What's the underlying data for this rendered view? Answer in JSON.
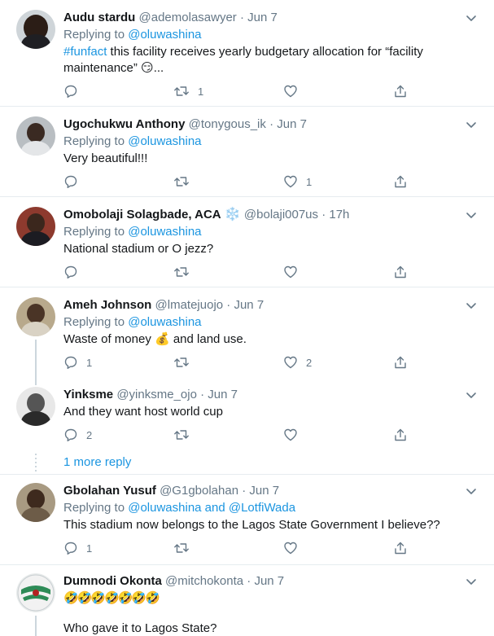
{
  "tweets": [
    {
      "name": "Audu stardu",
      "handle": "@ademolasawyer",
      "time": "Jun 7",
      "replying_prefix": "Replying to",
      "replying_to": "@oluwashina",
      "hashtag": "#funfact",
      "text": " this facility receives yearly budgetary allocation for “facility maintenance” 😏...",
      "reply_count": "",
      "retweet_count": "1",
      "like_count": ""
    },
    {
      "name": "Ugochukwu Anthony",
      "handle": "@tonygous_ik",
      "time": "Jun 7",
      "replying_prefix": "Replying to",
      "replying_to": "@oluwashina",
      "text": "Very beautiful!!!",
      "reply_count": "",
      "retweet_count": "",
      "like_count": "1"
    },
    {
      "name": "Omobolaji Solagbade, ACA",
      "badge": "❄️",
      "handle": "@bolaji007us",
      "time": "17h",
      "replying_prefix": "Replying to",
      "replying_to": "@oluwashina",
      "text": "National stadium or O jezz?",
      "reply_count": "",
      "retweet_count": "",
      "like_count": ""
    },
    {
      "name": "Ameh Johnson",
      "handle": "@lmatejuojo",
      "time": "Jun 7",
      "replying_prefix": "Replying to",
      "replying_to": "@oluwashina",
      "text": "Waste of money 💰 and land use.",
      "reply_count": "1",
      "retweet_count": "",
      "like_count": "2"
    },
    {
      "name": "Yinksme",
      "handle": "@yinksme_ojo",
      "time": "Jun 7",
      "text": "And they want host world cup",
      "reply_count": "2",
      "retweet_count": "",
      "like_count": ""
    },
    {
      "name": "Gbolahan Yusuf",
      "handle": "@G1gbolahan",
      "time": "Jun 7",
      "replying_prefix": "Replying to",
      "replying_to": "@oluwashina and @LotfiWada",
      "text": "This stadium now belongs to the Lagos State Government I believe??",
      "reply_count": "1",
      "retweet_count": "",
      "like_count": ""
    },
    {
      "name": "Dumnodi Okonta",
      "handle": "@mitchokonta",
      "time": "Jun 7",
      "text": "🤣🤣🤣🤣🤣🤣🤣",
      "text2": "Who gave it to Lagos State?"
    }
  ],
  "more_replies": "1 more reply",
  "separator": "·",
  "colors": {
    "link": "#1b95e0",
    "secondary_text": "#657786",
    "divider": "#e6ecf0",
    "thread_line": "#ccd6dd"
  }
}
